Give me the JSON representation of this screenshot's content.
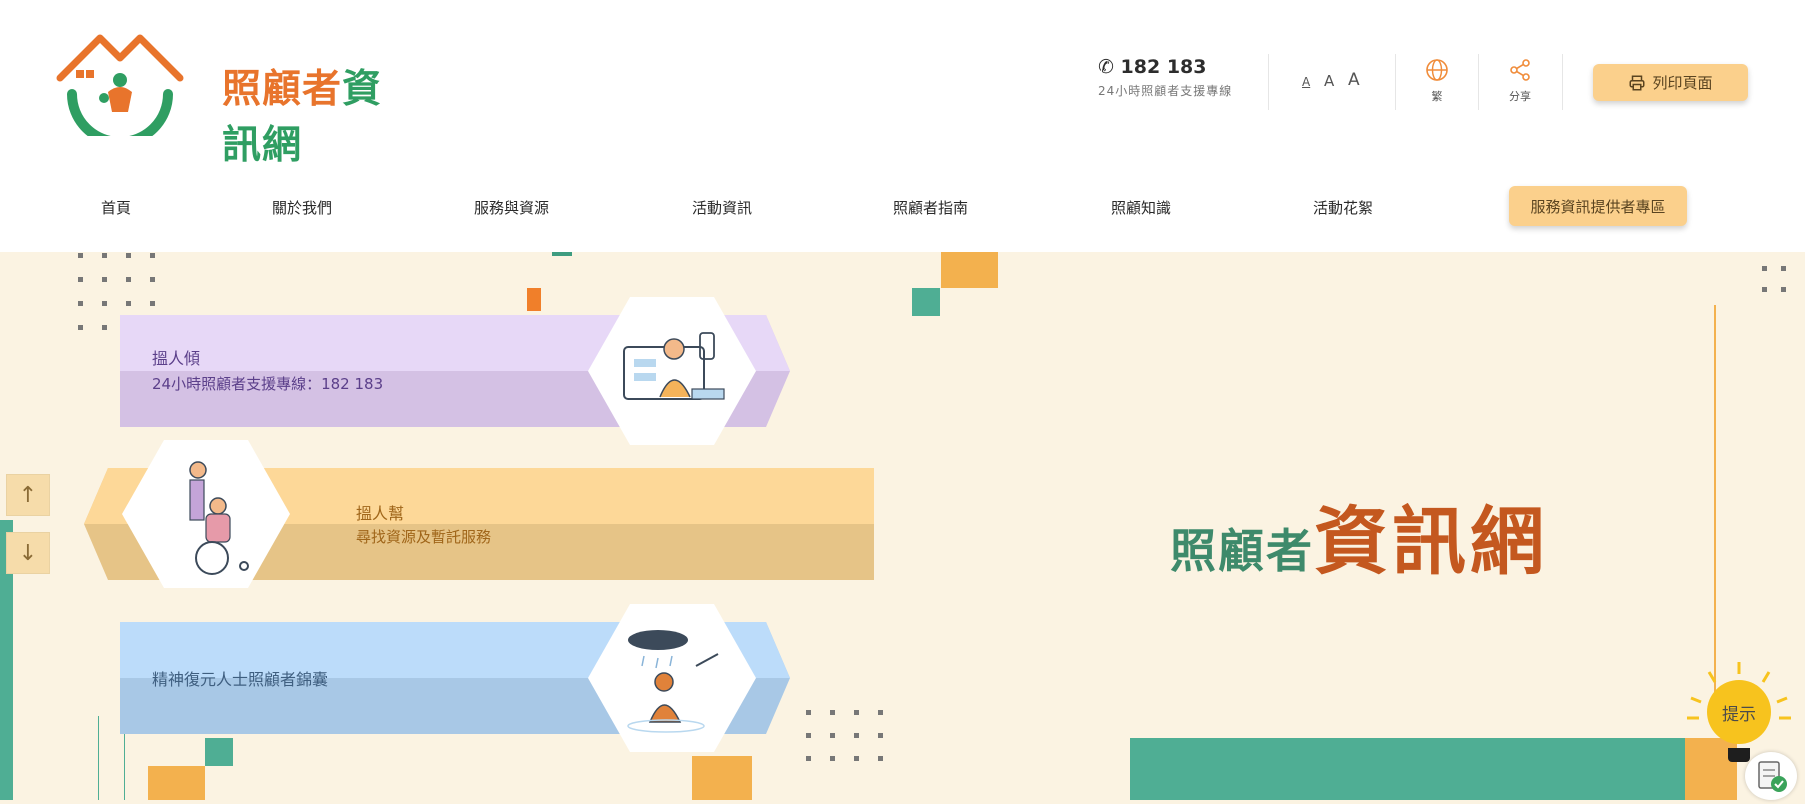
{
  "header": {
    "logo_text_orange": "照顧者",
    "logo_text_green": "資訊網",
    "hotline_number": "182 183",
    "hotline_desc": "24小時照顧者支援專線",
    "font_sizes": [
      "A",
      "A",
      "A"
    ],
    "language_label": "繁",
    "share_label": "分享",
    "print_label": "列印頁面"
  },
  "nav": {
    "items": [
      "首頁",
      "關於我們",
      "服務與資源",
      "活動資訊",
      "照顧者指南",
      "照顧知識",
      "活動花絮"
    ],
    "special": "服務資訊提供者專區"
  },
  "cards": [
    {
      "title": "搵人傾",
      "subtitle": "24小時照顧者支援專線：182 183"
    },
    {
      "title": "搵人幫",
      "subtitle": "尋找資源及暫託服務"
    },
    {
      "title": "精神復元人士照顧者錦囊",
      "subtitle": ""
    }
  ],
  "side_buttons": {
    "up": "↑",
    "down": "↓"
  },
  "hero": {
    "line1": "照顧者",
    "line2": "資訊網"
  },
  "tip_label": "提示",
  "colors": {
    "orange": "#e8742c",
    "green": "#3e8a6b",
    "teal": "#4fae94",
    "gold": "#fbd08c",
    "bg": "#fbf3e2"
  }
}
